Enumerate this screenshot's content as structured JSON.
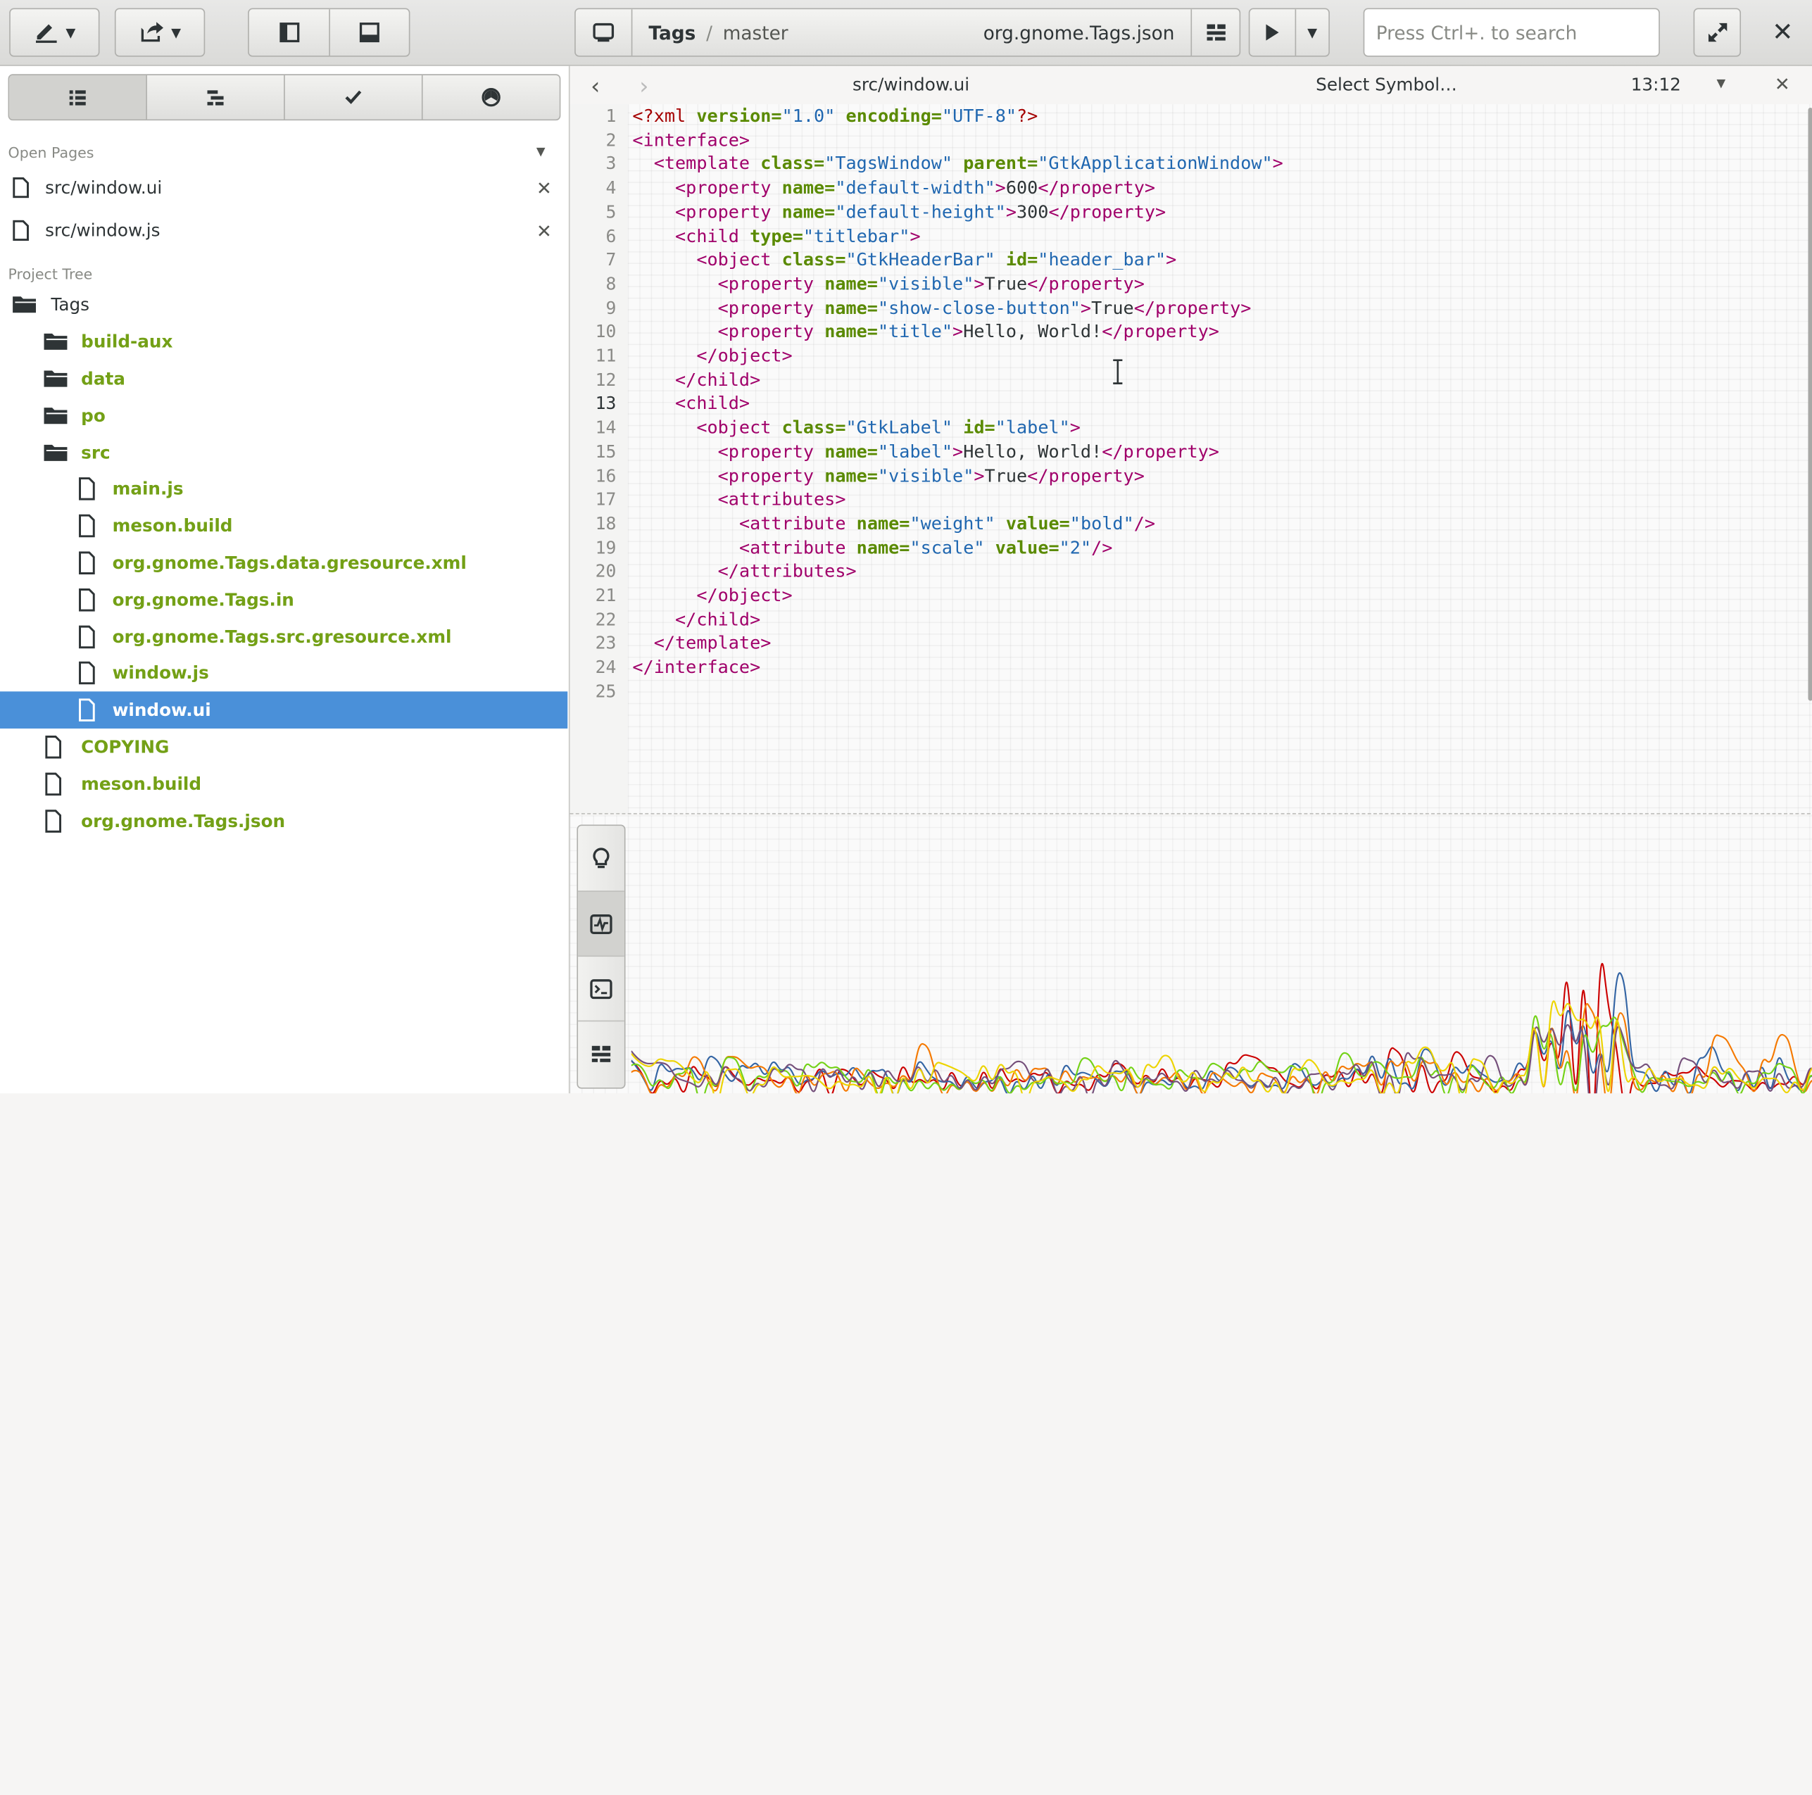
{
  "header": {
    "breadcrumb": {
      "project": "Tags",
      "separator": "/",
      "branch": "master",
      "config": "org.gnome.Tags.json"
    },
    "search": {
      "placeholder": "Press Ctrl+. to search"
    },
    "close_label": "✕"
  },
  "sidebar": {
    "open_pages_title": "Open Pages",
    "open_pages": [
      {
        "label": "src/window.ui"
      },
      {
        "label": "src/window.js"
      }
    ],
    "project_tree_title": "Project Tree",
    "tree": [
      {
        "label": "Tags"
      },
      {
        "label": "build-aux"
      },
      {
        "label": "data"
      },
      {
        "label": "po"
      },
      {
        "label": "src"
      },
      {
        "label": "main.js"
      },
      {
        "label": "meson.build"
      },
      {
        "label": "org.gnome.Tags.data.gresource.xml"
      },
      {
        "label": "org.gnome.Tags.in"
      },
      {
        "label": "org.gnome.Tags.src.gresource.xml"
      },
      {
        "label": "window.js"
      },
      {
        "label": "window.ui"
      },
      {
        "label": "COPYING"
      },
      {
        "label": "meson.build"
      },
      {
        "label": "org.gnome.Tags.json"
      }
    ]
  },
  "editor": {
    "filename": "src/window.ui",
    "symbol_label": "Select Symbol…",
    "cursor_position": "13:12",
    "current_line": 13,
    "line_numbers": [
      "1",
      "2",
      "3",
      "4",
      "5",
      "6",
      "7",
      "8",
      "9",
      "10",
      "11",
      "12",
      "13",
      "14",
      "15",
      "16",
      "17",
      "18",
      "19",
      "20",
      "21",
      "22",
      "23",
      "24",
      "25"
    ]
  },
  "colors": {
    "accent": "#4a90d9",
    "folder_text": "#73a016",
    "tag": "#a0006a",
    "attr": "#5a8a00",
    "string": "#2067b0"
  },
  "icons": {
    "header": [
      "edit-icon",
      "document-export-icon",
      "sidebar-left-icon",
      "panel-bottom-icon",
      "window-icon",
      "build-icon",
      "run-icon",
      "fullscreen-icon",
      "close-icon"
    ],
    "sidebar_tabs": [
      "list-icon",
      "symbol-tree-icon",
      "todo-check-icon",
      "palette-icon"
    ],
    "panel": [
      "lightbulb-icon",
      "activity-monitor-icon",
      "terminal-icon",
      "build-log-icon"
    ]
  }
}
